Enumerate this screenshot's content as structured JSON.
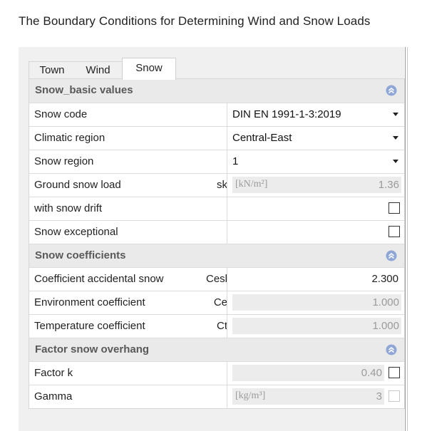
{
  "window": {
    "title": "The Boundary Conditions for Determining Wind and Snow Loads"
  },
  "tabs": [
    {
      "label": "Town",
      "active": false
    },
    {
      "label": "Wind",
      "active": false
    },
    {
      "label": "Snow",
      "active": true
    }
  ],
  "sections": {
    "basic": {
      "title": "Snow_basic values",
      "rows": {
        "snow_code": {
          "label": "Snow code",
          "value": "DIN EN 1991-1-3:2019"
        },
        "climatic_region": {
          "label": "Climatic region",
          "value": "Central-East"
        },
        "snow_region": {
          "label": "Snow region",
          "value": "1"
        },
        "ground_snow_load": {
          "label": "Ground snow load",
          "symbol": "sk",
          "unit": "[kN/m²]",
          "value": "1.36"
        },
        "snow_drift": {
          "label": "with snow drift",
          "checked": false
        },
        "snow_exceptional": {
          "label": "Snow exceptional",
          "checked": false
        }
      }
    },
    "coefficients": {
      "title": "Snow coefficients",
      "rows": {
        "accidental": {
          "label": "Coefficient accidental snow",
          "symbol": "Cesl",
          "value": "2.300"
        },
        "environment": {
          "label": "Environment coefficient",
          "symbol": "Ce",
          "value": "1.000"
        },
        "temperature": {
          "label": "Temperature coefficient",
          "symbol": "Ct",
          "value": "1.000"
        }
      }
    },
    "overhang": {
      "title": "Factor snow overhang",
      "rows": {
        "factor_k": {
          "label": "Factor k",
          "value": "0.40",
          "checked": false
        },
        "gamma": {
          "label": "Gamma",
          "unit": "[kg/m³]",
          "value": "3",
          "checked": false
        }
      }
    }
  },
  "colors": {
    "section_bg": "#eaeaea",
    "section_text": "#595959",
    "collapse_icon": "#8fa6d6",
    "readonly_bg": "#ececec"
  },
  "icons": {
    "collapse": "double-chevron-up-icon",
    "dropdown": "chevron-down-icon"
  }
}
